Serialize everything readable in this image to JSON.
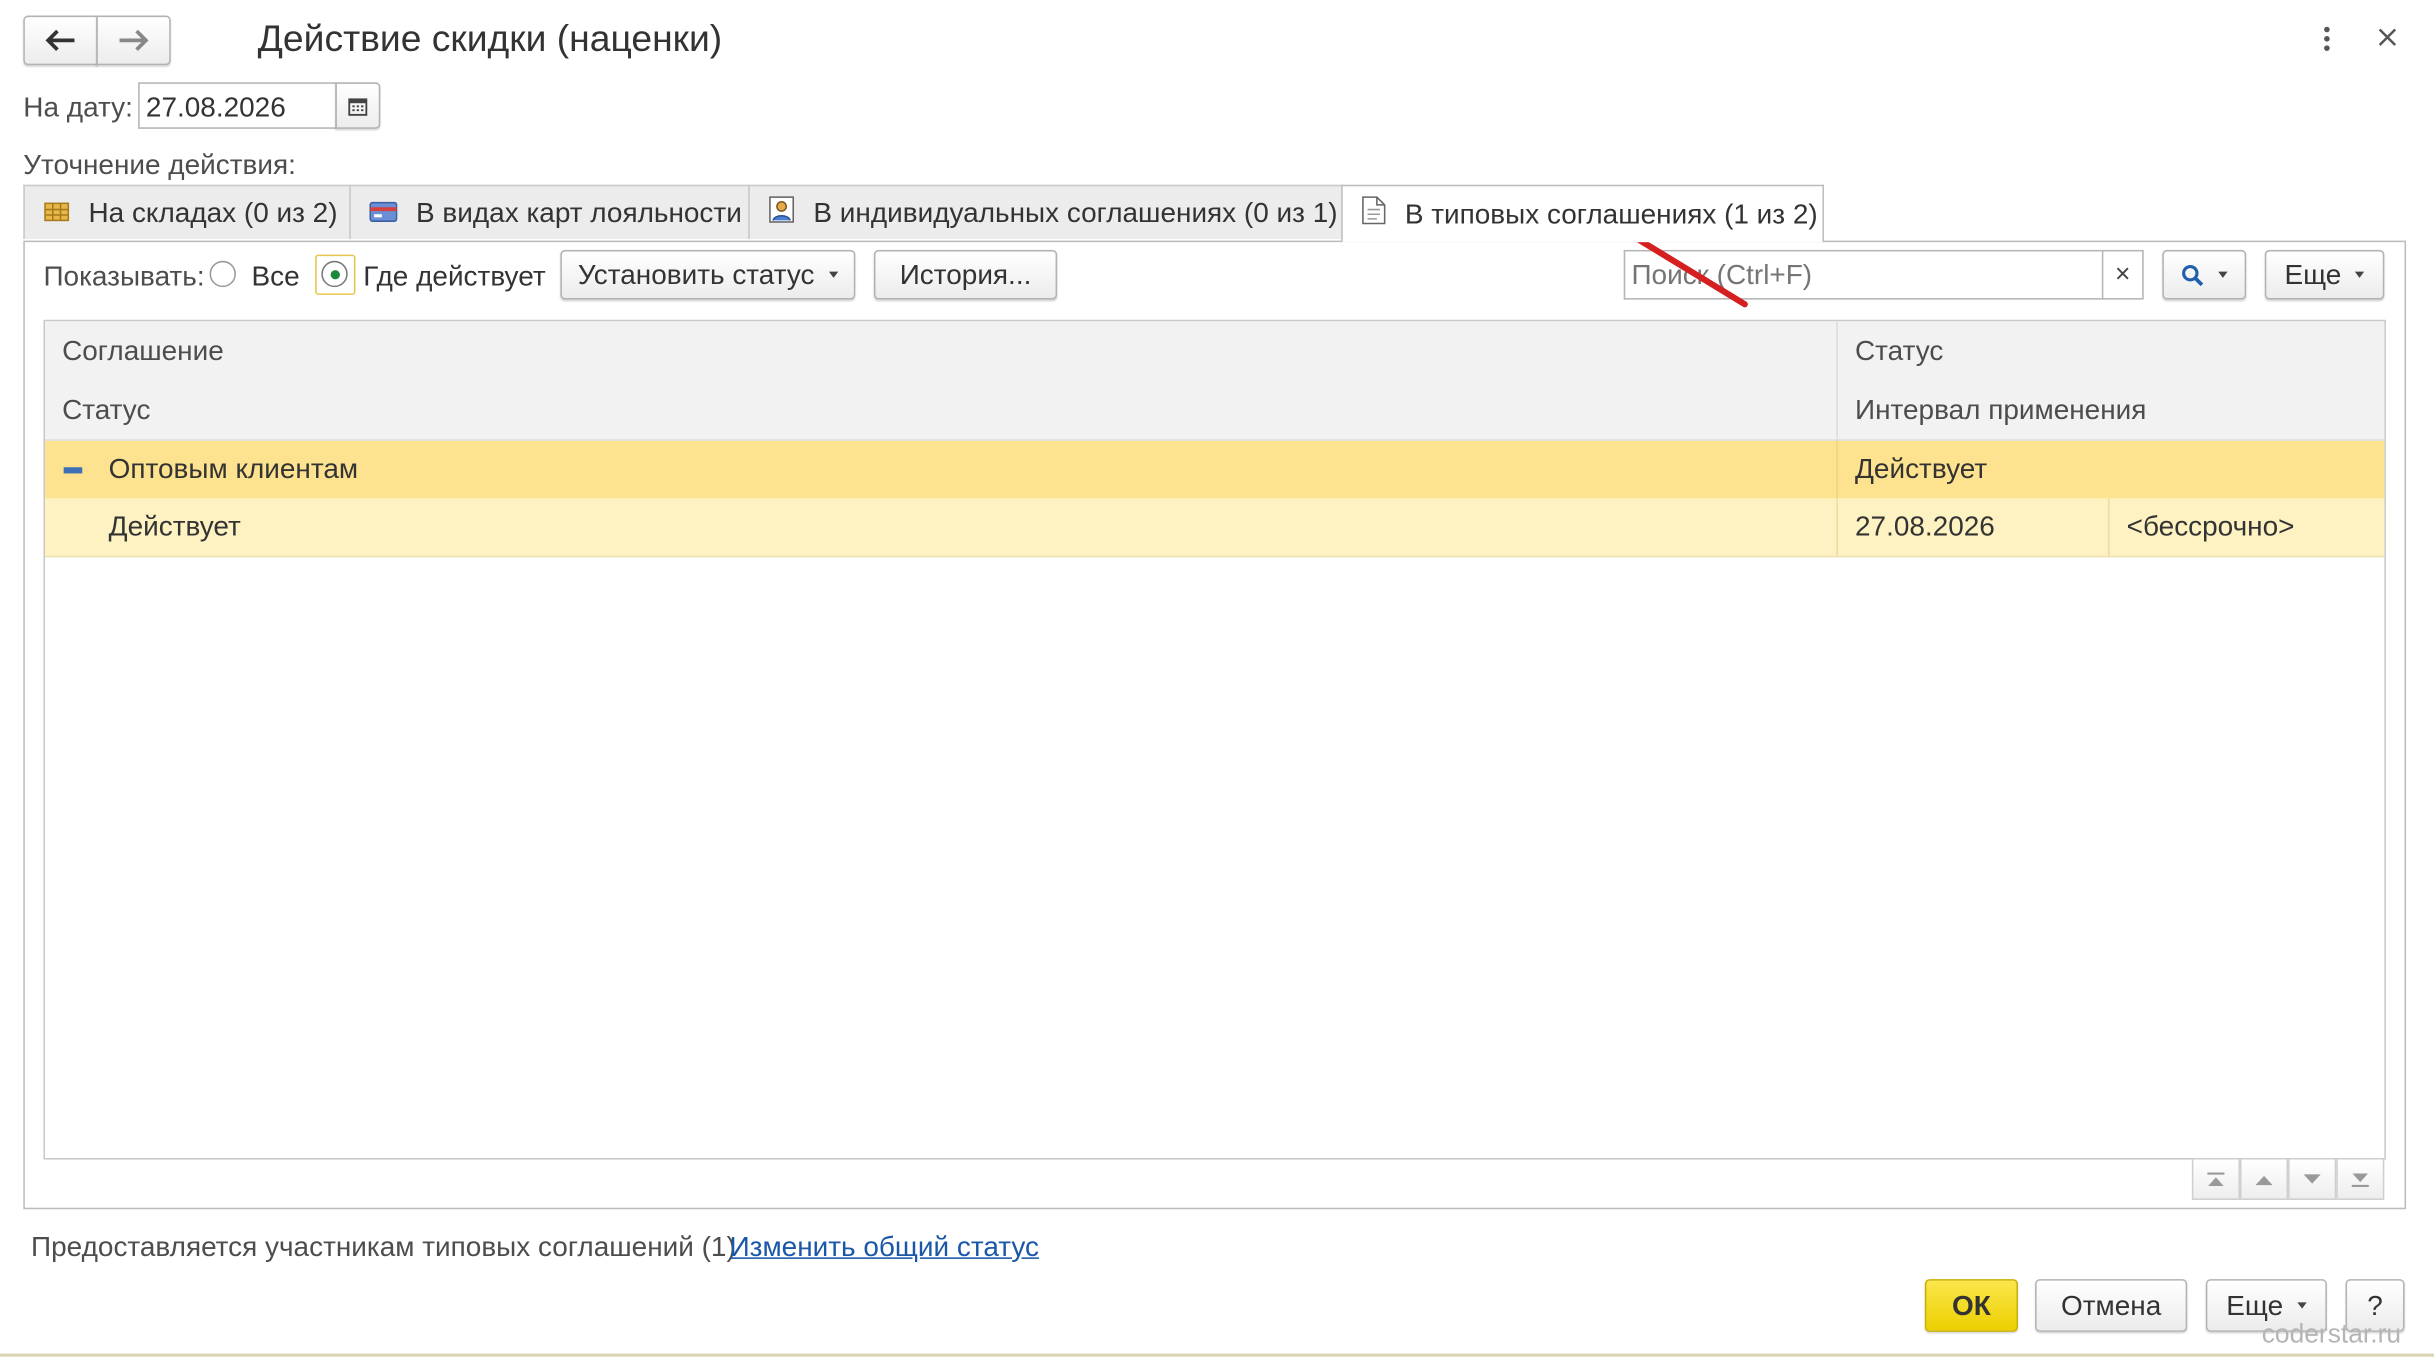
{
  "window": {
    "title": "Действие скидки (наценки)"
  },
  "date_field": {
    "label": "На дату:",
    "value": "27.08.2026"
  },
  "refinement_label": "Уточнение действия:",
  "tabs": [
    {
      "label": "На складах (0 из 2)",
      "icon": "warehouse-icon",
      "active": false
    },
    {
      "label": "В видах карт лояльности",
      "icon": "loyalty-card-icon",
      "active": false
    },
    {
      "label": "В индивидуальных соглашениях (0 из 1)",
      "icon": "person-agreement-icon",
      "active": false
    },
    {
      "label": "В типовых соглашениях (1 из 2)",
      "icon": "document-icon",
      "active": true
    }
  ],
  "toolbar": {
    "show_label": "Показывать:",
    "radio_all": "Все",
    "radio_active": "Где действует",
    "radio_selected": "active",
    "set_status_button": "Установить статус",
    "history_button": "История...",
    "more_button": "Еще"
  },
  "search": {
    "placeholder": "Поиск (Ctrl+F)",
    "value": "",
    "clear_icon": "×"
  },
  "grid": {
    "header_row1": {
      "col1": "Соглашение",
      "col2": "Статус"
    },
    "header_row2": {
      "col1": "Статус",
      "col2": "Интервал применения"
    },
    "group_row": {
      "name": "Оптовым клиентам",
      "status": "Действует"
    },
    "detail_row": {
      "status": "Действует",
      "date_from": "27.08.2026",
      "date_to": "<бессрочно>"
    }
  },
  "footer": {
    "info_text": "Предоставляется участникам типовых соглашений (1)",
    "change_link": "Изменить общий статус"
  },
  "buttons": {
    "ok": "ОК",
    "cancel": "Отмена",
    "more": "Еще",
    "help": "?"
  },
  "watermark": "coderstar.ru",
  "colors": {
    "selected_row": "#fde38f",
    "detail_row": "#fef2c2",
    "ok_button": "#f5d900",
    "link": "#1a57a8",
    "arrow_annotation": "#d42020"
  }
}
